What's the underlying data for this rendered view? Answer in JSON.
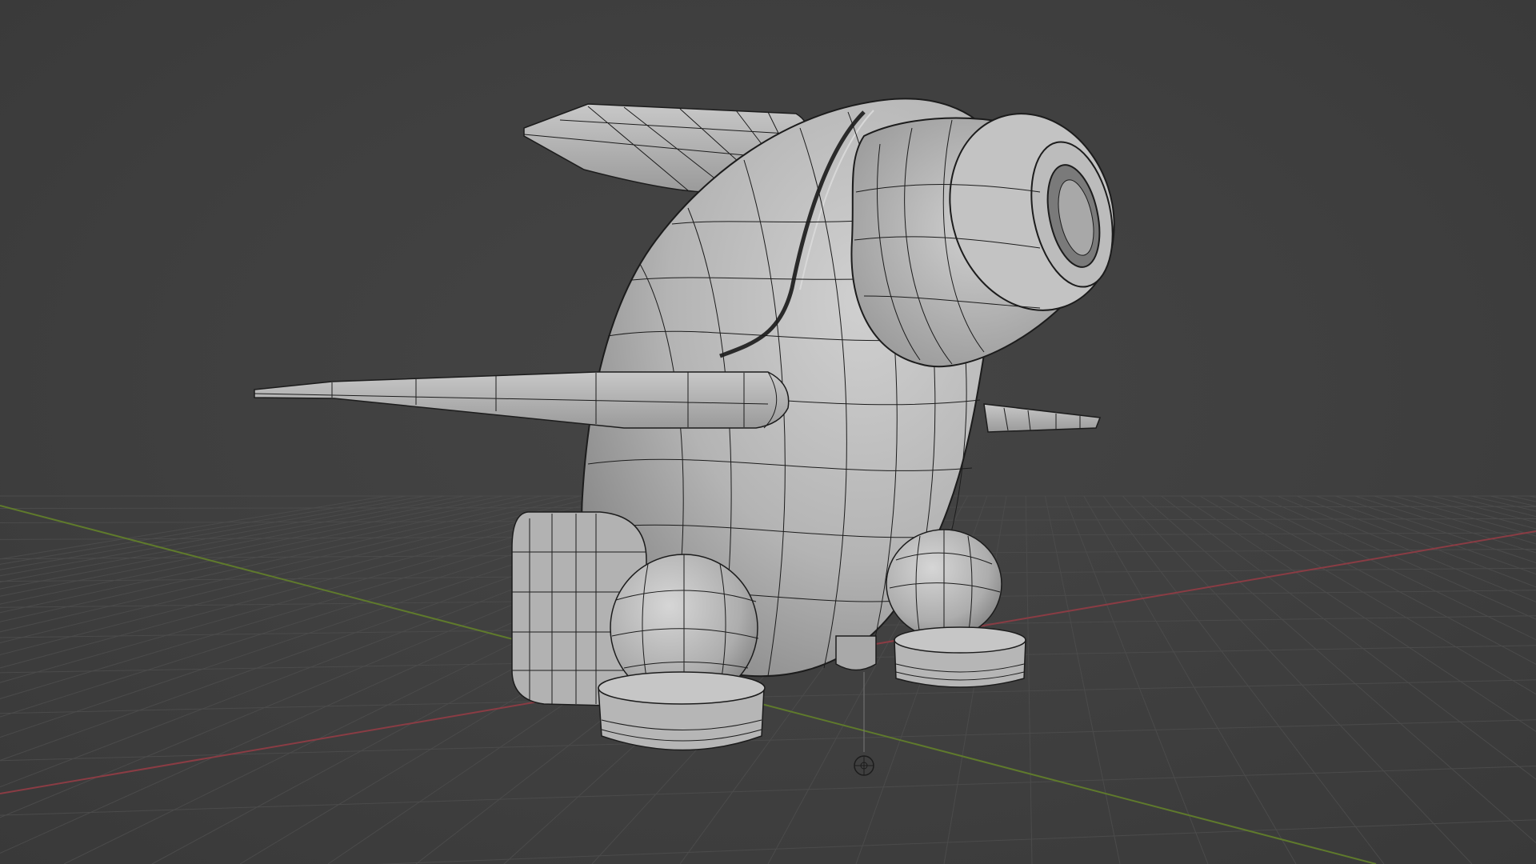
{
  "viewport": {
    "background_color": "#3d3d3d",
    "grid_color": "#4a4a4a",
    "x_axis_color": "#8a3c44",
    "y_axis_color": "#5f7a2c"
  },
  "model": {
    "surface_color": "#bdbdbd",
    "shadow_color": "#8f8f8f",
    "wire_color": "#1c1c1c"
  },
  "icons": {
    "origin": "origin-icon"
  }
}
